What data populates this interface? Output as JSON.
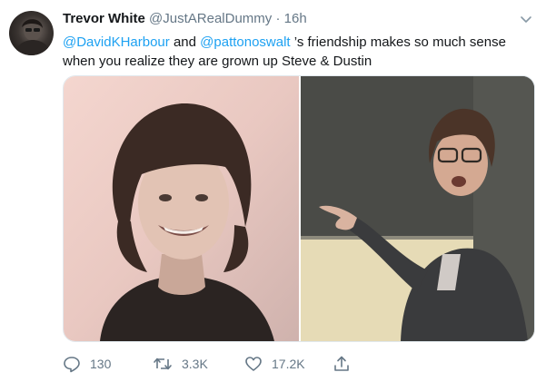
{
  "tweet": {
    "author": {
      "display_name": "Trevor White",
      "handle": "@JustARealDummy",
      "separator": "·",
      "time": "16h"
    },
    "text": {
      "mention_1": "@DavidKHarbour",
      "connector": " and ",
      "mention_2": "@pattonoswalt",
      "rest": " ’s friendship makes so much sense when you realize they are grown up Steve & Dustin"
    },
    "media": [
      {
        "icon": "photo-young-man-curly-hair"
      },
      {
        "icon": "photo-boy-with-glasses-pointing"
      }
    ],
    "actions": {
      "replies": "130",
      "retweets": "3.3K",
      "likes": "17.2K"
    },
    "menu_icon": "chevron-down-icon",
    "colors": {
      "link": "#1da1f2",
      "muted": "#657786",
      "text": "#14171a"
    }
  }
}
